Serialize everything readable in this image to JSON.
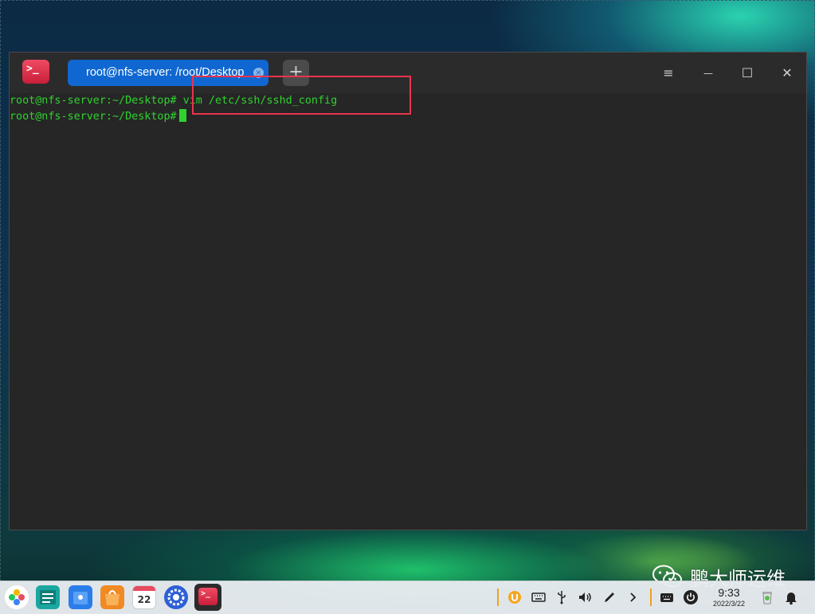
{
  "window": {
    "app_icon": "terminal-icon",
    "tab_title": "root@nfs-server: /root/Desktop",
    "tab_close": "×",
    "new_tab": "+",
    "controls": {
      "menu": "≡",
      "minimize": "—",
      "maximize": "☐",
      "close": "✕"
    }
  },
  "terminal": {
    "lines": [
      "root@nfs-server:~/Desktop# vim /etc/ssh/sshd_config",
      "root@nfs-server:~/Desktop#"
    ],
    "text_color": "#2fd32f",
    "background": "#262626"
  },
  "annotation": {
    "color": "#e8344e"
  },
  "watermark": {
    "text": "鹏大师运维",
    "icon": "wechat-icon"
  },
  "taskbar": {
    "dock": [
      "launcher-icon",
      "file-manager-icon",
      "app-store-icon",
      "shop-icon",
      "calendar-icon",
      "settings-icon",
      "terminal-icon"
    ],
    "calendar_day": "22",
    "tray": [
      "onboard-icon",
      "keyboard-icon",
      "usb-icon",
      "volume-icon",
      "pen-icon",
      "chevron-right-icon",
      "input-method-icon",
      "power-icon",
      "trash-icon",
      "notification-bell-icon"
    ],
    "clock_time": "9:33",
    "clock_date": "2022/3/22"
  }
}
